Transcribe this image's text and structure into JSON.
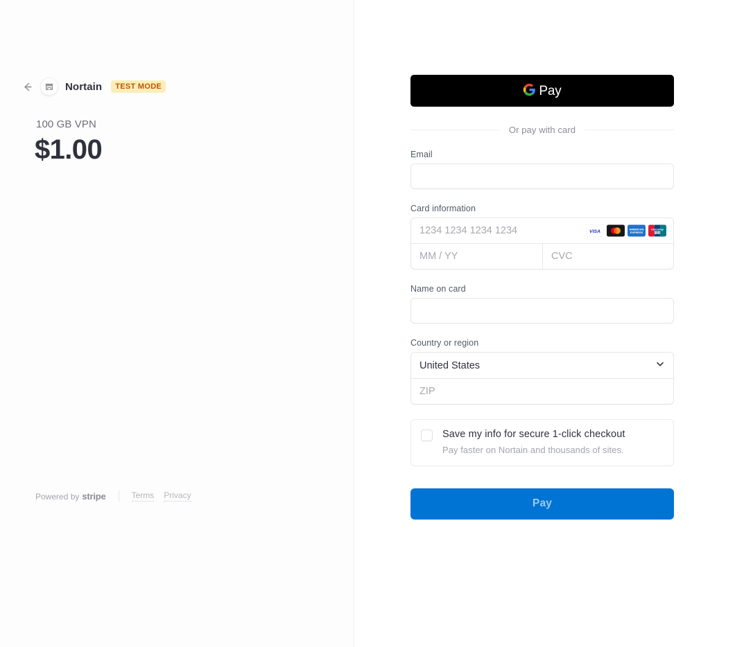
{
  "summary": {
    "back_icon": "back-arrow-icon",
    "merchant_logo_icon": "storefront-icon",
    "merchant_name": "Nortain",
    "test_mode_badge": "TEST MODE",
    "product_name": "100 GB VPN",
    "price": "$1.00"
  },
  "footer": {
    "powered_by_prefix": "Powered by",
    "powered_by_brand": "stripe",
    "terms_label": "Terms",
    "privacy_label": "Privacy"
  },
  "payment": {
    "gpay": {
      "logo_icon": "google-g-icon",
      "label": "Pay"
    },
    "divider_text": "Or pay with card",
    "email": {
      "label": "Email",
      "value": "",
      "placeholder": ""
    },
    "card": {
      "label": "Card information",
      "number_placeholder": "1234 1234 1234 1234",
      "number_value": "",
      "expiry_placeholder": "MM / YY",
      "expiry_value": "",
      "cvc_placeholder": "CVC",
      "cvc_value": "",
      "brands": [
        "visa",
        "mastercard",
        "amex",
        "unionpay"
      ]
    },
    "name_on_card": {
      "label": "Name on card",
      "value": "",
      "placeholder": ""
    },
    "country": {
      "label": "Country or region",
      "selected": "United States",
      "options": [
        "United States"
      ],
      "chevron_icon": "chevron-down-icon",
      "zip_placeholder": "ZIP",
      "zip_value": ""
    },
    "save_info": {
      "checked": false,
      "title": "Save my info for secure 1-click checkout",
      "subtitle": "Pay faster on Nortain and thousands of sites."
    },
    "submit_label": "Pay"
  },
  "colors": {
    "accent_blue": "#0074d4",
    "test_badge_bg": "#fcedb9",
    "test_badge_text": "#bb5504",
    "gpay_bg": "#000000"
  }
}
